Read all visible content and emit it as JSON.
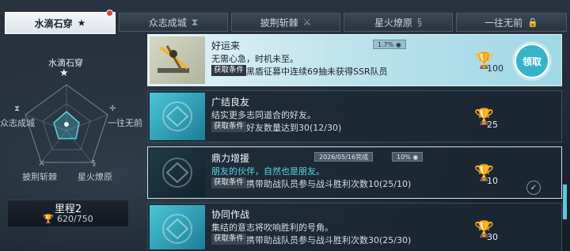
{
  "tabs": [
    {
      "label": "水滴石穿",
      "icon": "star-icon",
      "active": true,
      "badge": true
    },
    {
      "label": "众志成城",
      "icon": "hourglass-icon"
    },
    {
      "label": "披荆斩棘",
      "icon": "sword-icon"
    },
    {
      "label": "星火燎原",
      "icon": "s-emblem-icon"
    },
    {
      "label": "一往无前",
      "icon": "lock-icon",
      "locked": true
    }
  ],
  "radar": {
    "title": "水滴石穿",
    "labels": {
      "left": "众志成城",
      "right": "一往无前",
      "bottom_left": "披荆斩棘",
      "bottom_right": "星火燎原"
    }
  },
  "mileage": {
    "title": "里程2",
    "count": "620/750"
  },
  "condition_label": "获取条件",
  "achievements": [
    {
      "title": "好运来",
      "desc": "无需心急，时机未至。",
      "condition": "黑盾征募中连续69抽未获得SSR队员",
      "meta": "1.7%",
      "trophy": "100",
      "state": "claimable",
      "claim_label": "领取"
    },
    {
      "title": "广结良友",
      "desc": "结实更多志同道合的好友。",
      "condition": "好友数量达到30(12/30)",
      "trophy": "25",
      "state": "locked"
    },
    {
      "title": "鼎力增援",
      "desc": "朋友的伙伴，自然也是朋友。",
      "condition": "携带助战队员参与战斗胜利次数10(25/10)",
      "meta_date": "2026/05/16完成",
      "meta": "10%",
      "trophy": "10",
      "state": "completed"
    },
    {
      "title": "协同作战",
      "desc": "集结的意志将吹响胜利的号角。",
      "condition": "携带助战队员参与战斗胜利次数30(25/30)",
      "trophy": "30",
      "state": "locked"
    }
  ],
  "colors": {
    "accent": "#36b3c9",
    "accent_text": "#55d9e8",
    "badge": "#e0453b"
  }
}
